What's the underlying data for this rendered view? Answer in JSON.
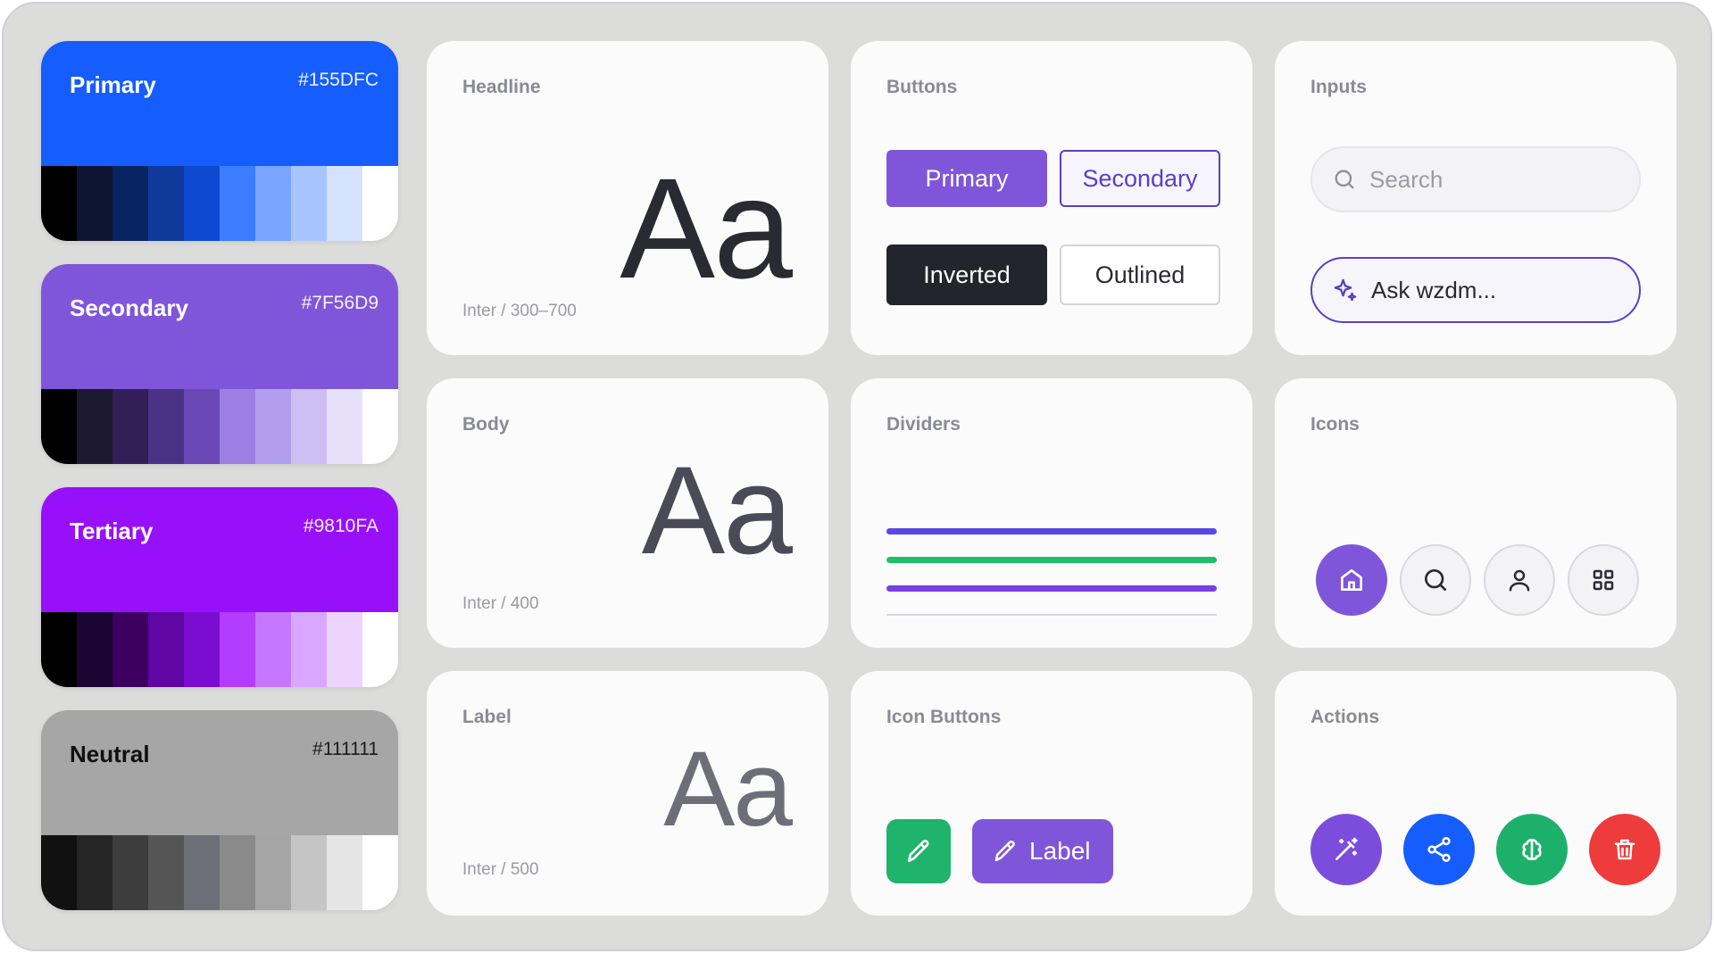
{
  "palettes": [
    {
      "name": "Primary",
      "hex": "#155DFC",
      "base": "#155DFC",
      "shades": [
        "#000000",
        "#0e1533",
        "#082561",
        "#0f3a9c",
        "#0e4ad1",
        "#3e7cff",
        "#79a4ff",
        "#a8c4ff",
        "#d4e2ff",
        "#ffffff"
      ]
    },
    {
      "name": "Secondary",
      "hex": "#7F56D9",
      "base": "#7F56D9",
      "shades": [
        "#000000",
        "#1e1933",
        "#321f57",
        "#4a3285",
        "#6a48b6",
        "#9d7fe3",
        "#b39ded",
        "#cdbff3",
        "#e6e0fa",
        "#ffffff"
      ]
    },
    {
      "name": "Tertiary",
      "hex": "#9810FA",
      "base": "#9810FA",
      "shades": [
        "#000000",
        "#1d0533",
        "#3b0060",
        "#5f06a3",
        "#7b0dd1",
        "#b23cff",
        "#c677ff",
        "#d9a7ff",
        "#ecd4ff",
        "#ffffff"
      ]
    },
    {
      "name": "Neutral",
      "hex": "#111111",
      "base": "#a6a6a6",
      "shades": [
        "#111111",
        "#262626",
        "#3d3d3d",
        "#555555",
        "#6e6e77",
        "#8a8a8a",
        "#a5a5a5",
        "#c5c5c5",
        "#e5e5e5",
        "#ffffff"
      ]
    }
  ],
  "headline": {
    "title": "Headline",
    "sample": "Aa",
    "meta": "Inter / 300–700"
  },
  "body": {
    "title": "Body",
    "sample": "Aa",
    "meta": "Inter / 400"
  },
  "label": {
    "title": "Label",
    "sample": "Aa",
    "meta": "Inter / 500"
  },
  "buttons": {
    "title": "Buttons",
    "primary": "Primary",
    "secondary": "Secondary",
    "inverted": "Inverted",
    "outlined": "Outlined"
  },
  "inputs": {
    "title": "Inputs",
    "search_placeholder": "Search",
    "ask_placeholder": "Ask wzdm..."
  },
  "dividers": {
    "title": "Dividers",
    "colors": [
      "#5b47e6",
      "#1fbf6a",
      "#7a3fe0",
      "#d6d6dc"
    ]
  },
  "icons": {
    "title": "Icons",
    "items": [
      "home-icon",
      "search-icon",
      "user-icon",
      "grid-icon"
    ]
  },
  "icon_buttons": {
    "title": "Icon Buttons",
    "label": "Label"
  },
  "actions": {
    "title": "Actions",
    "items": [
      {
        "icon": "magic-wand-icon",
        "color": "#7c4ddc"
      },
      {
        "icon": "share-icon",
        "color": "#155dfc"
      },
      {
        "icon": "brain-icon",
        "color": "#1cb06a"
      },
      {
        "icon": "trash-icon",
        "color": "#ee3b3b"
      }
    ]
  },
  "colors": {
    "accent": "#7f56d9",
    "inverted": "#24242c",
    "success": "#1fb36b",
    "danger": "#ee3b3b",
    "blue": "#155dfc"
  }
}
